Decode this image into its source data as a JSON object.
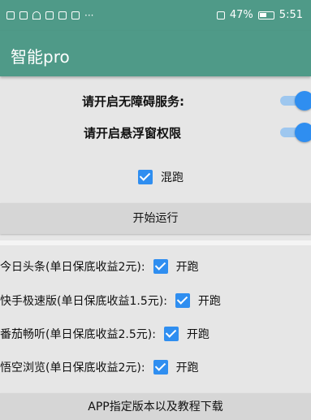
{
  "status_bar": {
    "left_icons": [
      "hd-icon",
      "signal-icon",
      "wifi-icon",
      "wechat-icon",
      "notification-icon",
      "app-icon",
      "more-icon"
    ],
    "battery": "47%",
    "time": "5:51"
  },
  "app": {
    "title": "智能pro"
  },
  "permissions": [
    {
      "label": "请开启无障碍服务:"
    },
    {
      "label": "请开启悬浮窗权限"
    }
  ],
  "mix_run": {
    "label": "混跑",
    "checked": true
  },
  "start_button": "开始运行",
  "tasks": [
    {
      "label": "今日头条(单日保底收益2元):",
      "toggle": "开跑",
      "checked": true
    },
    {
      "label": "快手极速版(单日保底收益1.5元):",
      "toggle": "开跑",
      "checked": true
    },
    {
      "label": "番茄畅听(单日保底收益2.5元):",
      "toggle": "开跑",
      "checked": true
    },
    {
      "label": "悟空浏览(单日保底收益2元):",
      "toggle": "开跑",
      "checked": true
    }
  ],
  "download_button": "APP指定版本以及教程下载",
  "colors": {
    "primary": "#4f9a88",
    "accent": "#2f8ef0",
    "background": "#e6e6e6"
  }
}
